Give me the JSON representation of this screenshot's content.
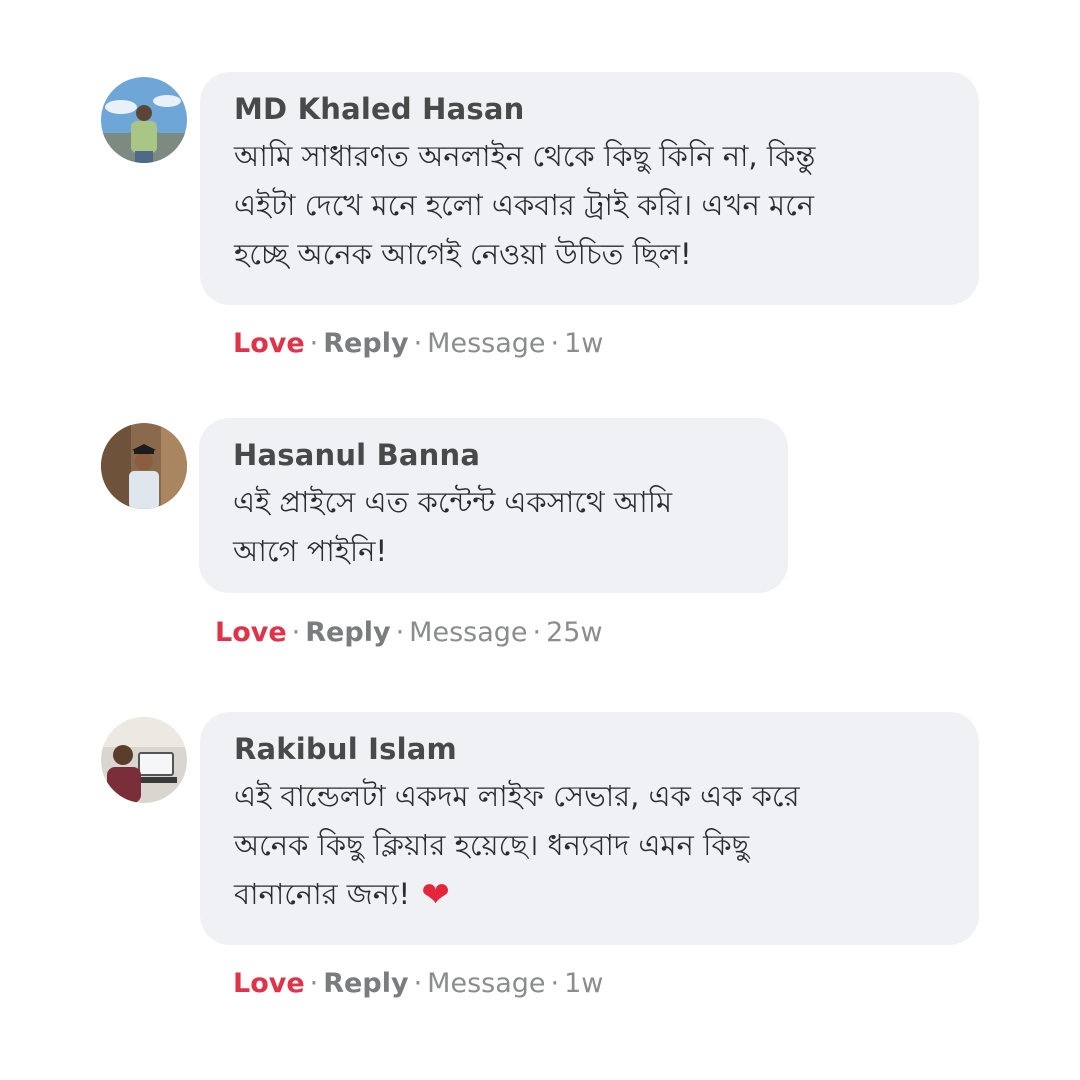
{
  "comments": [
    {
      "author": "MD Khaled Hasan",
      "lines": [
        "আমি সাধারণত অনলাইন থেকে কিছু কিনি না, কিন্তু",
        "এইটা দেখে মনে হলো একবার ট্রাই করি। এখন মনে",
        "হচ্ছে অনেক আগেই নেওয়া উচিত ছিল!"
      ],
      "actions": {
        "love": "Love",
        "reply": "Reply",
        "message": "Message",
        "separator": "·",
        "time": "1w"
      }
    },
    {
      "author": "Hasanul Banna",
      "lines": [
        "এই প্রাইসে এত কন্টেন্ট একসাথে আমি",
        "আগে পাইনি!"
      ],
      "actions": {
        "love": "Love",
        "reply": "Reply",
        "message": "Message",
        "separator": "·",
        "time": "25w"
      }
    },
    {
      "author": "Rakibul Islam",
      "lines": [
        "এই বান্ডেলটা একদম লাইফ সেভার, এক এক করে",
        "অনেক কিছু ক্লিয়ার হয়েছে। ধন্যবাদ এমন কিছু",
        "বানানোর জন্য!"
      ],
      "emoji": "❤",
      "actions": {
        "love": "Love",
        "reply": "Reply",
        "message": "Message",
        "separator": "·",
        "time": "1w"
      }
    }
  ],
  "colors": {
    "bubble": "#f0f1f5",
    "love": "#e0334a",
    "author": "#464a48",
    "meta": "#8a8c8e",
    "heart": "#e4253c"
  }
}
